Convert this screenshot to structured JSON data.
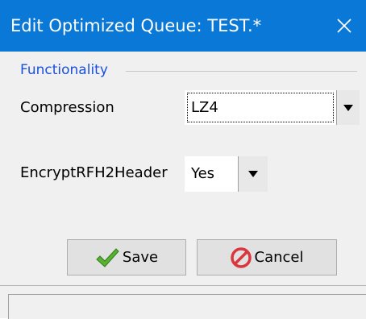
{
  "window": {
    "title": "Edit Optimized Queue: TEST.*",
    "close_symbol": "✕"
  },
  "group": {
    "label": "Functionality"
  },
  "fields": {
    "compression": {
      "label": "Compression",
      "value": "LZ4"
    },
    "encrypt_rfh2": {
      "label": "EncryptRFH2Header",
      "value": "Yes"
    }
  },
  "buttons": {
    "save_label": "Save",
    "cancel_label": "Cancel"
  },
  "icons": {
    "save": "checkmark-icon",
    "cancel": "no-entry-icon",
    "dropdown": "triangle-down-icon"
  },
  "colors": {
    "titlebar": "#0a78d7",
    "group_label": "#1a4fd6",
    "check_green": "#58b12f",
    "cancel_red": "#d9363e"
  }
}
